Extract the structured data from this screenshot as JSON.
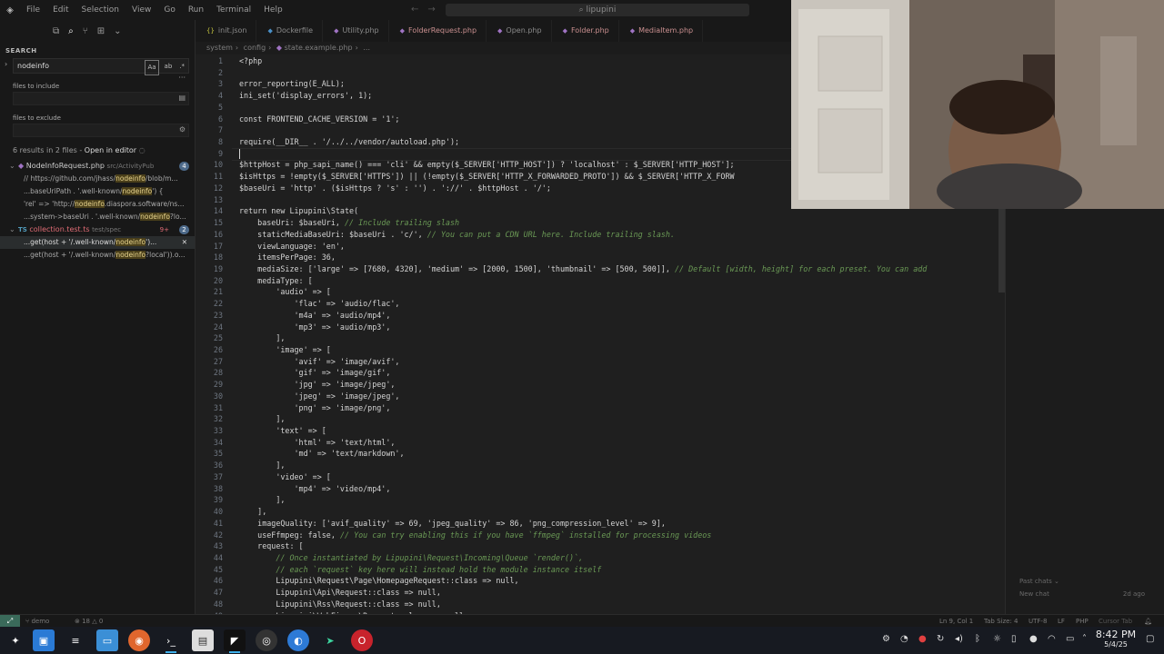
{
  "titlebar": {
    "menus": [
      "File",
      "Edit",
      "Selection",
      "View",
      "Go",
      "Run",
      "Terminal",
      "Help"
    ],
    "command_center": "lipupini"
  },
  "sidebar": {
    "title": "SEARCH",
    "query": "nodeinfo",
    "match_case": "Aa",
    "files_to_include_label": "files to include",
    "files_to_exclude_label": "files to exclude",
    "summary": "6 results in 2 files - ",
    "open_in_editor": "Open in editor",
    "results": [
      {
        "file": "NodeInfoRequest.php",
        "path": "src/ActivityPub",
        "count": "4",
        "type": "php",
        "lines": [
          {
            "pre": "// https://github.com/jhass/",
            "match": "nodeinfo",
            "post": "/blob/m..."
          },
          {
            "pre": "...baseUriPath . '.well-known/",
            "match": "nodeinfo",
            "post": "') {"
          },
          {
            "pre": "'rel' => 'http://",
            "match": "nodeinfo",
            "post": ".diaspora.software/ns..."
          },
          {
            "pre": "...system->baseUri . '.well-known/",
            "match": "nodeinfo",
            "post": "?lo..."
          }
        ]
      },
      {
        "file": "collection.test.ts",
        "path": "test/spec",
        "count": "2",
        "mod": "9+",
        "type": "ts",
        "lines": [
          {
            "pre": "...get(host + '/.well-known/",
            "match": "nodeinfo",
            "post": "')...",
            "selected": true
          },
          {
            "pre": "...get(host + '/.well-known/",
            "match": "nodeinfo",
            "post": "?local')).o..."
          }
        ]
      }
    ]
  },
  "tabs": [
    {
      "label": "init.json",
      "icon": "{}",
      "kind": "json"
    },
    {
      "label": "Dockerfile",
      "icon": "◆",
      "kind": "docker"
    },
    {
      "label": "Utility.php",
      "icon": "◆",
      "kind": "php"
    },
    {
      "label": "FolderRequest.php",
      "icon": "◆",
      "kind": "php",
      "modified": true
    },
    {
      "label": "Open.php",
      "icon": "◆",
      "kind": "php"
    },
    {
      "label": "Folder.php",
      "icon": "◆",
      "kind": "php",
      "modified": true
    },
    {
      "label": "MediaItem.php",
      "icon": "◆",
      "kind": "php",
      "modified": true
    }
  ],
  "breadcrumb": [
    "system",
    "config",
    "state.example.php",
    "..."
  ],
  "editor": {
    "current_line": 9,
    "lines": [
      {
        "n": "1",
        "t": "<?php"
      },
      {
        "n": "2",
        "t": ""
      },
      {
        "n": "3",
        "t": "error_reporting(E_ALL);"
      },
      {
        "n": "4",
        "t": "ini_set('display_errors', 1);"
      },
      {
        "n": "5",
        "t": ""
      },
      {
        "n": "6",
        "t": "const FRONTEND_CACHE_VERSION = '1';"
      },
      {
        "n": "7",
        "t": ""
      },
      {
        "n": "8",
        "t": "require(__DIR__ . '/../../vendor/autoload.php');"
      },
      {
        "n": "9",
        "t": ""
      },
      {
        "n": "10",
        "t": "$httpHost = php_sapi_name() === 'cli' && empty($_SERVER['HTTP_HOST']) ? 'localhost' : $_SERVER['HTTP_HOST'];"
      },
      {
        "n": "11",
        "t": "$isHttps = !empty($_SERVER['HTTPS']) || (!empty($_SERVER['HTTP_X_FORWARDED_PROTO']) && $_SERVER['HTTP_X_FORW"
      },
      {
        "n": "12",
        "t": "$baseUri = 'http' . ($isHttps ? 's' : '') . '://' . $httpHost . '/';"
      },
      {
        "n": "13",
        "t": ""
      },
      {
        "n": "14",
        "t": "return new Lipupini\\State("
      },
      {
        "n": "15",
        "t": "    baseUri: $baseUri, // Include trailing slash"
      },
      {
        "n": "16",
        "t": "    staticMediaBaseUri: $baseUri . 'c/', // You can put a CDN URL here. Include trailing slash."
      },
      {
        "n": "17",
        "t": "    viewLanguage: 'en',"
      },
      {
        "n": "18",
        "t": "    itemsPerPage: 36,"
      },
      {
        "n": "19",
        "t": "    mediaSize: ['large' => [7680, 4320], 'medium' => [2000, 1500], 'thumbnail' => [500, 500]], // Default [width, height] for each preset. You can add"
      },
      {
        "n": "20",
        "t": "    mediaType: ["
      },
      {
        "n": "21",
        "t": "        'audio' => ["
      },
      {
        "n": "22",
        "t": "            'flac' => 'audio/flac',"
      },
      {
        "n": "23",
        "t": "            'm4a' => 'audio/mp4',"
      },
      {
        "n": "24",
        "t": "            'mp3' => 'audio/mp3',"
      },
      {
        "n": "25",
        "t": "        ],"
      },
      {
        "n": "26",
        "t": "        'image' => ["
      },
      {
        "n": "27",
        "t": "            'avif' => 'image/avif',"
      },
      {
        "n": "28",
        "t": "            'gif' => 'image/gif',"
      },
      {
        "n": "29",
        "t": "            'jpg' => 'image/jpeg',"
      },
      {
        "n": "30",
        "t": "            'jpeg' => 'image/jpeg',"
      },
      {
        "n": "31",
        "t": "            'png' => 'image/png',"
      },
      {
        "n": "32",
        "t": "        ],"
      },
      {
        "n": "33",
        "t": "        'text' => ["
      },
      {
        "n": "34",
        "t": "            'html' => 'text/html',"
      },
      {
        "n": "35",
        "t": "            'md' => 'text/markdown',"
      },
      {
        "n": "36",
        "t": "        ],"
      },
      {
        "n": "37",
        "t": "        'video' => ["
      },
      {
        "n": "38",
        "t": "            'mp4' => 'video/mp4',"
      },
      {
        "n": "39",
        "t": "        ],"
      },
      {
        "n": "40",
        "t": "    ],"
      },
      {
        "n": "41",
        "t": "    imageQuality: ['avif_quality' => 69, 'jpeg_quality' => 86, 'png_compression_level' => 9],"
      },
      {
        "n": "42",
        "t": "    useFfmpeg: false, // You can try enabling this if you have `ffmpeg` installed for processing videos"
      },
      {
        "n": "43",
        "t": "    request: ["
      },
      {
        "n": "44",
        "t": "        // Once instantiated by Lipupini\\Request\\Incoming\\Queue `render()`,"
      },
      {
        "n": "45",
        "t": "        // each `request` key here will instead hold the module instance itself"
      },
      {
        "n": "46",
        "t": "        Lipupini\\Request\\Page\\HomepageRequest::class => null,"
      },
      {
        "n": "47",
        "t": "        Lipupini\\Api\\Request::class => null,"
      },
      {
        "n": "48",
        "t": "        Lipupini\\Rss\\Request::class => null,"
      },
      {
        "n": "49",
        "t": "        Lipupini\\WebFinger\\Request::class => null,"
      }
    ]
  },
  "chat_panel": {
    "past_chats": "Past chats",
    "new_chat": "New chat",
    "time_ago": "2d ago"
  },
  "statusbar": {
    "branch": "demo",
    "errors": "18",
    "warnings": "0",
    "position": "Ln 9, Col 1",
    "tab_size": "Tab Size: 4",
    "encoding": "UTF-8",
    "eol": "LF",
    "language": "PHP",
    "cursor_tab": "Cursor Tab"
  },
  "taskbar": {
    "time": "8:42 PM",
    "date": "5/4/25"
  },
  "colors": {
    "php_icon": "#a074c4",
    "match_highlight": "#4a3f1a",
    "keyword": "#569cd6",
    "string": "#ce9178",
    "comment": "#6a9955"
  }
}
